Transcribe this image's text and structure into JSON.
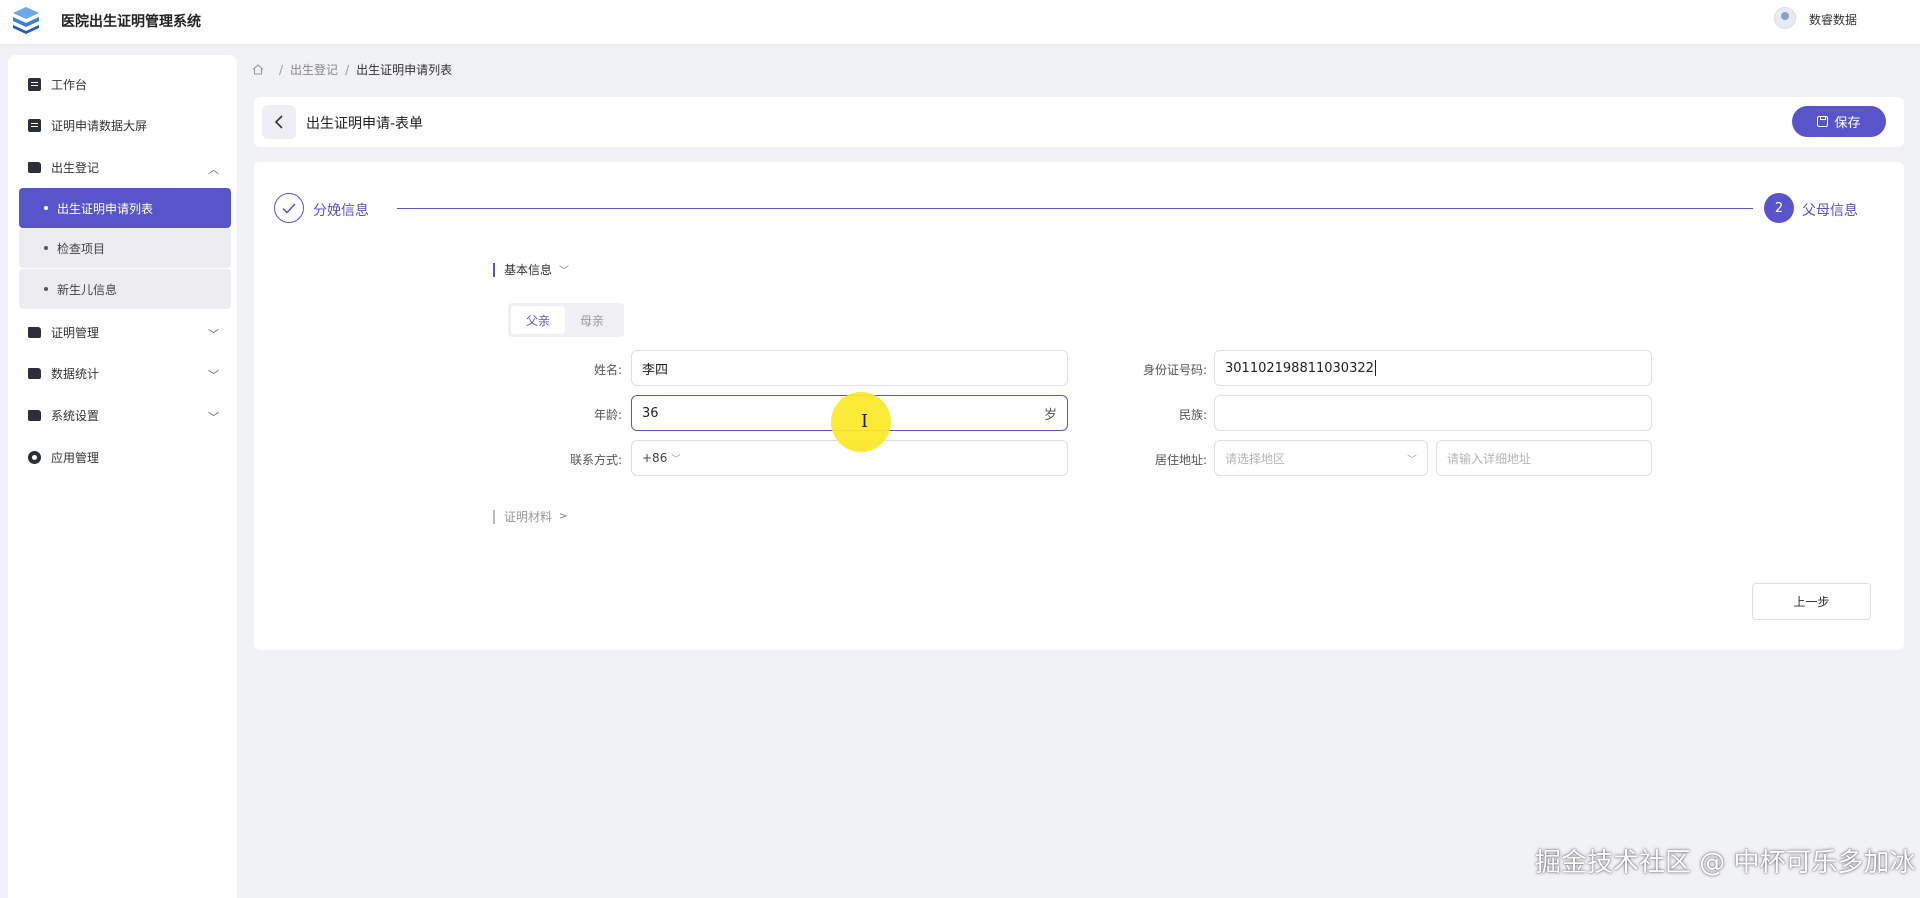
{
  "header": {
    "app_title": "医院出生证明管理系统",
    "user_name": "数睿数据"
  },
  "sidebar": {
    "items": [
      {
        "label": "工作台",
        "icon": "document-icon"
      },
      {
        "label": "证明申请数据大屏",
        "icon": "document-icon"
      },
      {
        "label": "出生登记",
        "icon": "folder-icon",
        "expanded": true,
        "children": [
          {
            "label": "出生证明申请列表",
            "active": true
          },
          {
            "label": "检查项目"
          },
          {
            "label": "新生儿信息"
          }
        ]
      },
      {
        "label": "证明管理",
        "icon": "folder-icon"
      },
      {
        "label": "数据统计",
        "icon": "folder-icon"
      },
      {
        "label": "系统设置",
        "icon": "folder-icon"
      },
      {
        "label": "应用管理",
        "icon": "gear-icon"
      }
    ]
  },
  "breadcrumb": {
    "items": [
      "出生登记",
      "出生证明申请列表"
    ],
    "separator": "/"
  },
  "titlebar": {
    "title": "出生证明申请-表单",
    "save_label": "保存"
  },
  "steps": {
    "step1": {
      "label": "分娩信息",
      "status": "done"
    },
    "step2": {
      "number": "2",
      "label": "父母信息",
      "status": "active"
    }
  },
  "sections": {
    "basic_info": "基本信息",
    "proof_materials": "证明材料"
  },
  "tabs": {
    "items": [
      "父亲",
      "母亲"
    ],
    "active": "父亲"
  },
  "form": {
    "name": {
      "label": "姓名:",
      "value": "李四"
    },
    "id_number": {
      "label": "身份证号码:",
      "value": "301102198811030322"
    },
    "age": {
      "label": "年龄:",
      "value": "36",
      "suffix": "岁"
    },
    "ethnicity": {
      "label": "民族:",
      "value": ""
    },
    "contact": {
      "label": "联系方式:",
      "prefix": "+86",
      "value": ""
    },
    "address": {
      "label": "居住地址:",
      "region_placeholder": "请选择地区",
      "detail_placeholder": "请输入详细地址"
    }
  },
  "actions": {
    "prev_label": "上一步"
  },
  "watermark": "掘金技术社区 @ 中杯可乐多加冰",
  "colors": {
    "accent": "#5755c9",
    "background": "#f1f2f6"
  }
}
